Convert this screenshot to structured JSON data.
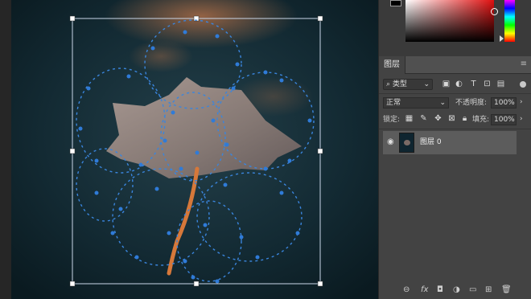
{
  "canvas": {
    "description_icon": "leaf-photo-with-path-anchors"
  },
  "color_panel": {
    "foreground": "#000000",
    "picker_hue": "#e01010"
  },
  "layers_panel": {
    "tab_label": "图层",
    "filter": {
      "label": "类型"
    },
    "blend_mode": "正常",
    "opacity_label": "不透明度:",
    "opacity_value": "100%",
    "lock_label": "锁定:",
    "fill_label": "填充:",
    "fill_value": "100%",
    "layers": [
      {
        "name": "图层 0",
        "visible": true
      }
    ]
  },
  "colors": {
    "path_blue": "#2f7bd8",
    "panel_bg": "#434343",
    "selected_layer": "#5c5c5c"
  }
}
